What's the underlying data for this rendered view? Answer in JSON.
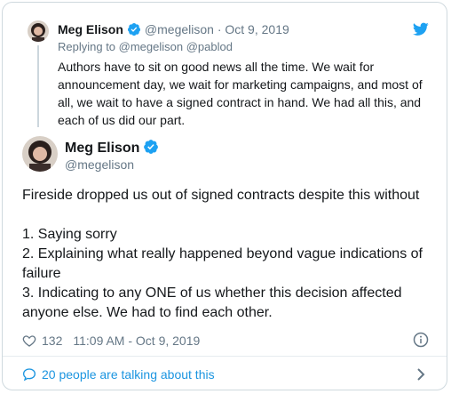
{
  "reply": {
    "name": "Meg Elison",
    "handle": "@megelison",
    "sep": "·",
    "date": "Oct 9, 2019",
    "replying_to": "Replying to @megelison @pablod",
    "text": "Authors have to sit on good news all the time. We wait for announcement day, we wait for marketing campaigns, and most of all, we wait to have a signed contract in hand. We had all this, and each of us did our part."
  },
  "tweet": {
    "name": "Meg Elison",
    "handle": "@megelison",
    "lines": [
      "Fireside dropped us out of signed contracts despite this without",
      "",
      "1. Saying sorry",
      "2. Explaining what really happened beyond vague indications of failure",
      "3. Indicating to any ONE of us whether this decision affected anyone else. We had to find each other."
    ],
    "likes": "132",
    "timestamp": "11:09 AM - Oct 9, 2019",
    "talking": "20 people are talking about this"
  },
  "colors": {
    "accent": "#1da1f2",
    "link": "#1b95e0",
    "muted": "#657786",
    "border": "#cfd9de"
  },
  "icons": [
    "verified-badge-icon",
    "twitter-bird-icon",
    "heart-icon",
    "info-icon",
    "speech-bubble-icon",
    "chevron-right-icon"
  ]
}
